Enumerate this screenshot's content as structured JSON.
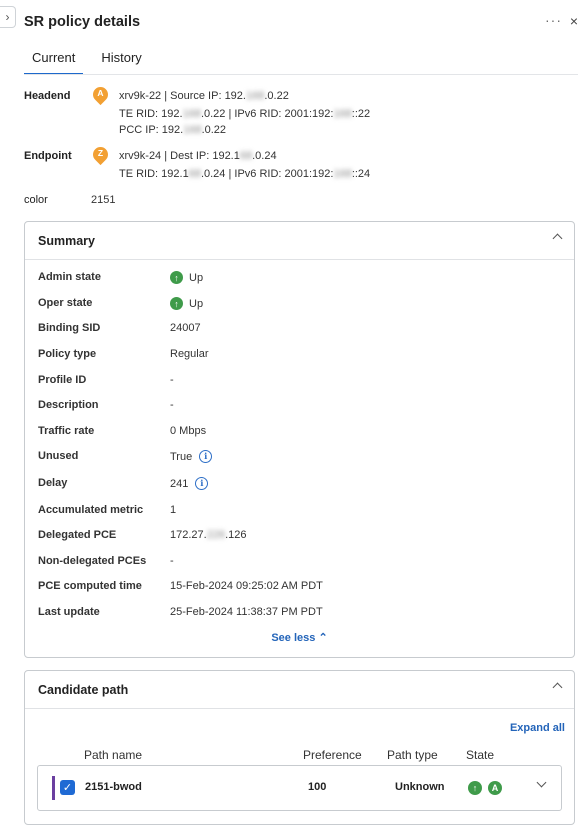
{
  "panel": {
    "title": "SR policy details",
    "more_glyph": "···",
    "collapse_glyph": "›",
    "close_glyph": "×"
  },
  "tabs": [
    {
      "label": "Current",
      "active": true
    },
    {
      "label": "History",
      "active": false
    }
  ],
  "headend": {
    "label": "Headend",
    "badge": "A",
    "line1": {
      "pre": "xrv9k-22 | Source IP: 192.",
      "masked": "168",
      "post": ".0.22"
    },
    "line2": {
      "a": "TE RID: 192.",
      "m1": "168",
      "b": ".0.22 | IPv6 RID: 2001:192:",
      "m2": "168",
      "c": "::22"
    },
    "line3": {
      "pre": "PCC IP: 192.",
      "masked": "168",
      "post": ".0.22"
    }
  },
  "endpoint": {
    "label": "Endpoint",
    "badge": "Z",
    "line1": {
      "pre": "xrv9k-24 | Dest IP: 192.1",
      "masked": "68",
      "post": ".0.24"
    },
    "line2": {
      "a": "TE RID: 192.1",
      "m1": "68",
      "b": ".0.24 | IPv6 RID: 2001:192:",
      "m2": "168",
      "c": "::24"
    }
  },
  "color": {
    "label": "color",
    "value": "2151"
  },
  "summary": {
    "title": "Summary",
    "rows": [
      {
        "key": "Admin state",
        "value": "Up",
        "icon": "arrow-up-icon"
      },
      {
        "key": "Oper state",
        "value": "Up",
        "icon": "arrow-up-icon"
      },
      {
        "key": "Binding SID",
        "value": "24007"
      },
      {
        "key": "Policy type",
        "value": "Regular"
      },
      {
        "key": "Profile ID",
        "value": "-"
      },
      {
        "key": "Description",
        "value": "-"
      },
      {
        "key": "Traffic rate",
        "value": "0 Mbps"
      },
      {
        "key": "Unused",
        "value": "True",
        "icon": "info-icon"
      },
      {
        "key": "Delay",
        "value": "241",
        "icon": "info-icon"
      },
      {
        "key": "Accumulated metric",
        "value": "1"
      },
      {
        "key": "Delegated PCE",
        "value_pre": "172.27.",
        "value_masked": "226",
        "value_post": ".126"
      },
      {
        "key": "Non-delegated PCEs",
        "value": "-"
      },
      {
        "key": "PCE computed time",
        "value": "15-Feb-2024 09:25:02 AM PDT"
      },
      {
        "key": "Last update",
        "value": "25-Feb-2024 11:38:37 PM PDT"
      }
    ],
    "see_less": "See less"
  },
  "candidate_path": {
    "title": "Candidate path",
    "expand_all": "Expand all",
    "columns": {
      "name": "Path name",
      "preference": "Preference",
      "type": "Path type",
      "state": "State"
    },
    "rows": [
      {
        "name": "2151-bwod",
        "preference": "100",
        "type": "Unknown",
        "checked": true,
        "state_badges": [
          "↑",
          "A"
        ]
      }
    ]
  },
  "colors": {
    "accent": "#1d69cc",
    "status_up": "#3f9b4a",
    "pin": "#f2a033",
    "path_bar": "#6b3fa0"
  }
}
